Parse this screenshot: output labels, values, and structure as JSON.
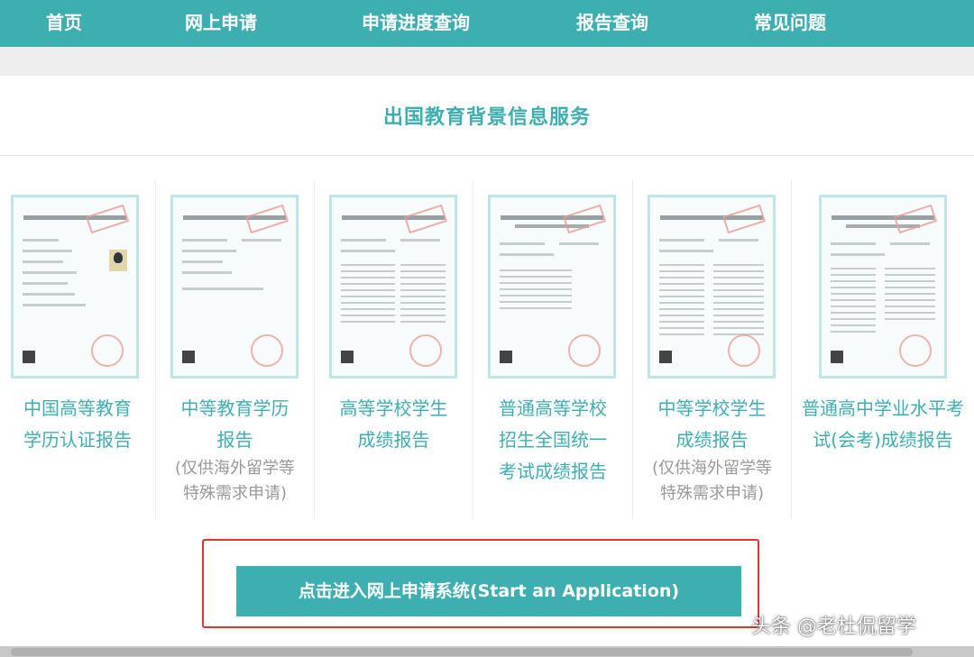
{
  "nav": {
    "items": [
      "首页",
      "网上申请",
      "申请进度查询",
      "报告查询",
      "常见问题"
    ],
    "color": "#3eafb0"
  },
  "section": {
    "title": "出国教育背景信息服务"
  },
  "cards": [
    {
      "label_line1": "中国高等教育",
      "label_line2": "学历认证报告",
      "label_line3": "",
      "note_line1": "",
      "note_line2": ""
    },
    {
      "label_line1": "中等教育学历",
      "label_line2": "报告",
      "label_line3": "",
      "note_line1": "(仅供海外留学等",
      "note_line2": "特殊需求申请)"
    },
    {
      "label_line1": "高等学校学生",
      "label_line2": "成绩报告",
      "label_line3": "",
      "note_line1": "",
      "note_line2": ""
    },
    {
      "label_line1": "普通高等学校",
      "label_line2": "招生全国统一",
      "label_line3": "考试成绩报告",
      "note_line1": "",
      "note_line2": ""
    },
    {
      "label_line1": "中等学校学生",
      "label_line2": "成绩报告",
      "label_line3": "",
      "note_line1": "(仅供海外留学等",
      "note_line2": "特殊需求申请)"
    },
    {
      "label_line1": "普通高中学业水平考",
      "label_line2": "试(会考)成绩报告",
      "label_line3": "",
      "note_line1": "",
      "note_line2": ""
    }
  ],
  "apply_button": {
    "label": "点击进入网上申请系统(Start an Application)"
  },
  "watermark": {
    "text": "头条 @老杜侃留学"
  },
  "colors": {
    "accent": "#3eafb0",
    "highlight_border": "#e8322e"
  }
}
